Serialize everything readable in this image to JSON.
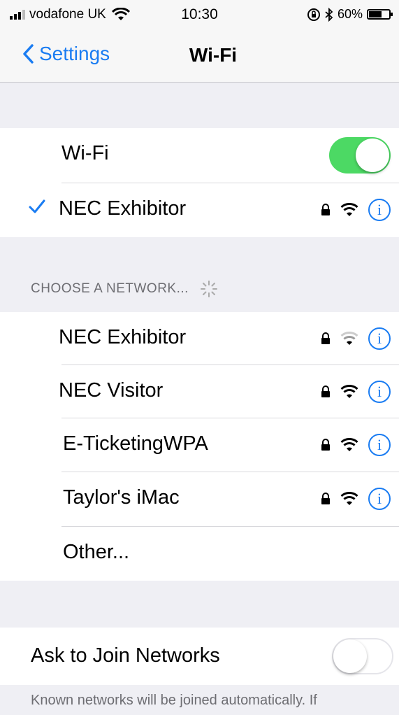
{
  "status_bar": {
    "carrier": "vodafone UK",
    "time": "10:30",
    "battery": "60%"
  },
  "nav": {
    "back_label": "Settings",
    "title": "Wi-Fi"
  },
  "wifi_toggle": {
    "label": "Wi-Fi",
    "on": true
  },
  "connected": {
    "name": "NEC Exhibitor",
    "locked": true
  },
  "networks_section": {
    "header": "CHOOSE A NETWORK..."
  },
  "networks": [
    {
      "name": "NEC Exhibitor",
      "locked": true,
      "signal": "weak"
    },
    {
      "name": "NEC Visitor",
      "locked": true,
      "signal": "strong"
    },
    {
      "name": "E-TicketingWPA",
      "locked": true,
      "signal": "strong"
    },
    {
      "name": "Taylor's iMac",
      "locked": true,
      "signal": "strong"
    }
  ],
  "other_label": "Other...",
  "ask_to_join": {
    "label": "Ask to Join Networks",
    "on": false
  },
  "footer": "Known networks will be joined automatically. If",
  "colors": {
    "accent": "#1a7cf2",
    "toggle_on": "#4cd964",
    "background": "#efeff4"
  }
}
